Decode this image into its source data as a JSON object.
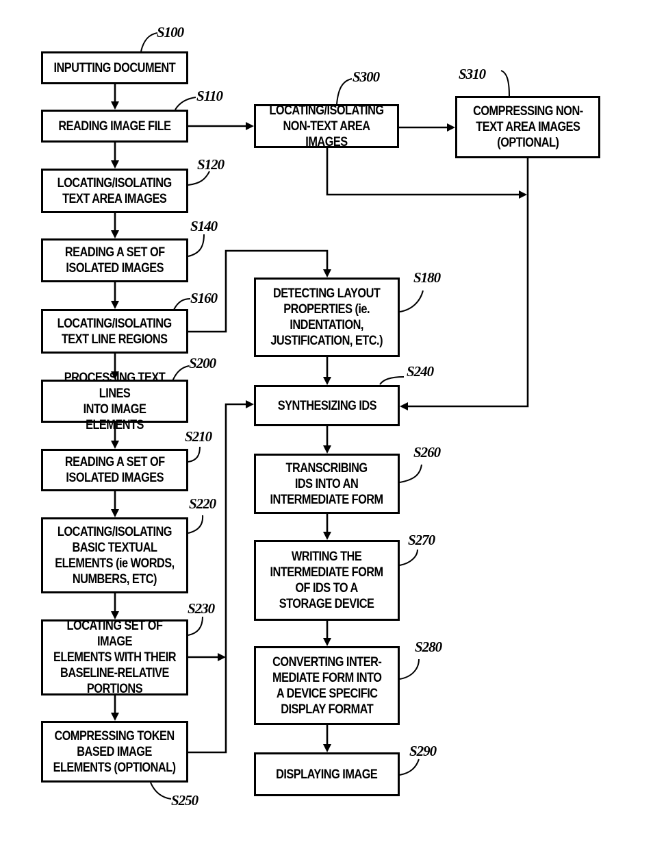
{
  "figure": {
    "type": "flowchart",
    "steps": {
      "S100": {
        "ref": "S100",
        "label": "INPUTTING DOCUMENT"
      },
      "S110": {
        "ref": "S110",
        "label": "READING IMAGE FILE"
      },
      "S120": {
        "ref": "S120",
        "label": "LOCATING/ISOLATING\nTEXT AREA IMAGES"
      },
      "S140": {
        "ref": "S140",
        "label": "READING A SET OF\nISOLATED IMAGES"
      },
      "S160": {
        "ref": "S160",
        "label": "LOCATING/ISOLATING\nTEXT LINE REGIONS"
      },
      "S200": {
        "ref": "S200",
        "label": "PROCESSING TEXT LINES\nINTO IMAGE ELEMENTS"
      },
      "S210": {
        "ref": "S210",
        "label": "READING A SET OF\nISOLATED IMAGES"
      },
      "S220": {
        "ref": "S220",
        "label": "LOCATING/ISOLATING\nBASIC TEXTUAL\nELEMENTS (ie WORDS,\nNUMBERS, ETC)"
      },
      "S230": {
        "ref": "S230",
        "label": "LOCATING SET OF IMAGE\nELEMENTS WITH THEIR\nBASELINE-RELATIVE\nPORTIONS"
      },
      "S250": {
        "ref": "S250",
        "label": "COMPRESSING TOKEN\nBASED IMAGE\nELEMENTS (OPTIONAL)"
      },
      "S300": {
        "ref": "S300",
        "label": "LOCATING/ISOLATING\nNON-TEXT AREA IMAGES"
      },
      "S310": {
        "ref": "S310",
        "label": "COMPRESSING NON-\nTEXT AREA IMAGES\n(OPTIONAL)"
      },
      "S180": {
        "ref": "S180",
        "label": "DETECTING LAYOUT\nPROPERTIES (ie.\nINDENTATION,\nJUSTIFICATION, ETC.)"
      },
      "S240": {
        "ref": "S240",
        "label": "SYNTHESIZING IDS"
      },
      "S260": {
        "ref": "S260",
        "label": "TRANSCRIBING\nIDS INTO AN\nINTERMEDIATE FORM"
      },
      "S270": {
        "ref": "S270",
        "label": "WRITING THE\nINTERMEDIATE FORM\nOF IDS TO A\nSTORAGE DEVICE"
      },
      "S280": {
        "ref": "S280",
        "label": "CONVERTING INTER-\nMEDIATE FORM INTO\nA DEVICE SPECIFIC\nDISPLAY FORMAT"
      },
      "S290": {
        "ref": "S290",
        "label": "DISPLAYING IMAGE"
      }
    },
    "edges": [
      [
        "S100",
        "S110"
      ],
      [
        "S110",
        "S120"
      ],
      [
        "S110",
        "S300"
      ],
      [
        "S120",
        "S140"
      ],
      [
        "S140",
        "S160"
      ],
      [
        "S160",
        "S200"
      ],
      [
        "S160",
        "S180"
      ],
      [
        "S200",
        "S210"
      ],
      [
        "S210",
        "S220"
      ],
      [
        "S220",
        "S230"
      ],
      [
        "S230",
        "S250"
      ],
      [
        "S230",
        "S240"
      ],
      [
        "S250",
        "S240"
      ],
      [
        "S300",
        "S310"
      ],
      [
        "S300",
        "S240"
      ],
      [
        "S310",
        "S240"
      ],
      [
        "S180",
        "S240"
      ],
      [
        "S240",
        "S260"
      ],
      [
        "S260",
        "S270"
      ],
      [
        "S270",
        "S280"
      ],
      [
        "S280",
        "S290"
      ]
    ]
  }
}
